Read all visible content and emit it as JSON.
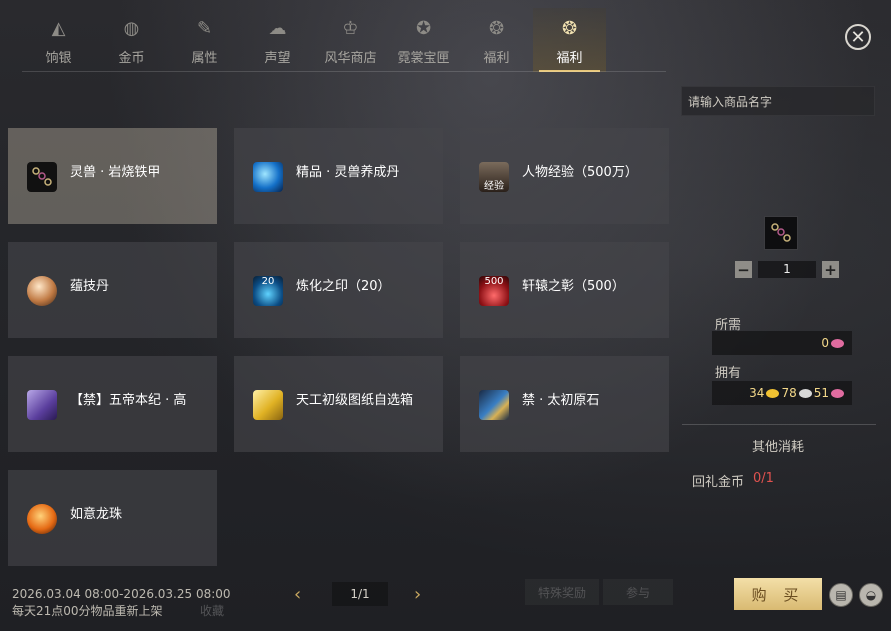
{
  "tabs": [
    {
      "label": "饷银",
      "icon": "ingot-icon"
    },
    {
      "label": "金币",
      "icon": "coin-icon"
    },
    {
      "label": "属性",
      "icon": "attribute-icon"
    },
    {
      "label": "声望",
      "icon": "reputation-icon"
    },
    {
      "label": "风华商店",
      "icon": "shop-icon"
    },
    {
      "label": "霓裳宝匣",
      "icon": "treasure-box-icon"
    },
    {
      "label": "福利",
      "icon": "welfare-icon"
    },
    {
      "label": "福利",
      "icon": "welfare-active-icon"
    }
  ],
  "active_tab_index": 7,
  "items": [
    {
      "name": "灵兽 · 岩烧铁甲",
      "icon": "armor-chain-icon",
      "selected": true
    },
    {
      "name": "精品 · 灵兽养成丹",
      "icon": "blue-orb-icon"
    },
    {
      "name": "人物经验（500万）",
      "icon": "portrait-icon",
      "badge": "经验"
    },
    {
      "name": "蕴技丹",
      "icon": "crystal-ball-icon"
    },
    {
      "name": "炼化之印（20）",
      "icon": "seal-icon",
      "badge": "20"
    },
    {
      "name": "轩辕之彰（500）",
      "icon": "red-emblem-icon",
      "badge": "500"
    },
    {
      "name": "【禁】五帝本纪 · 高",
      "icon": "book-icon"
    },
    {
      "name": "天工初级图纸自选箱",
      "icon": "gold-box-icon"
    },
    {
      "name": "禁 · 太初原石",
      "icon": "stone-icon"
    },
    {
      "name": "如意龙珠",
      "icon": "dragon-pearl-icon"
    }
  ],
  "search": {
    "placeholder": "请输入商品名字"
  },
  "quantity": {
    "value": "1",
    "minus": "−",
    "plus": "+"
  },
  "required": {
    "label": "所需",
    "value": "0"
  },
  "owned": {
    "label": "拥有",
    "gold": "34",
    "silver": "78",
    "pink": "51"
  },
  "other_cost": {
    "title": "其他消耗",
    "label": "回礼金币",
    "value": "0/1"
  },
  "buy_label": "购 买",
  "footer": {
    "date_range": "2026.03.04 08:00-2026.03.25 08:00",
    "restock": "每天21点00分物品重新上架",
    "ghost": "收藏"
  },
  "pager": {
    "page": "1/1"
  },
  "ghost_buttons": {
    "special": "特殊奖励",
    "join": "参与"
  },
  "colors": {
    "accent": "#e7c678",
    "buy": "#e8cf8e",
    "warning": "#e0524f"
  }
}
